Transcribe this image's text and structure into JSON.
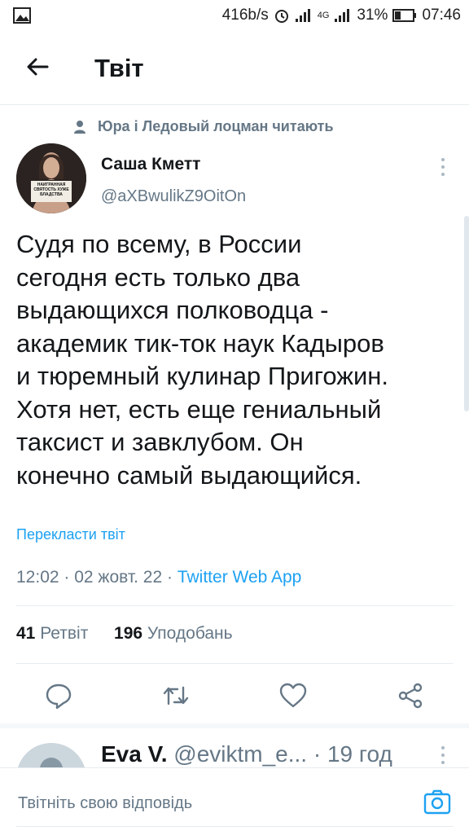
{
  "status": {
    "speed": "416b/s",
    "net": "4G",
    "battery": "31%",
    "time": "07:46"
  },
  "header": {
    "title": "Твіт"
  },
  "social_context": "Юра і Ледовый лоцман читають",
  "author": {
    "name": "Саша Кметт",
    "handle": "@aXBwulikZ9OitOn",
    "avatar_sign": "НАИГРАННАЯ СВЯТОСТЬ ХУЖЕ БЛАДСТВА"
  },
  "tweet": {
    "lines": [
      "Судя по всему, в России",
      "сегодня есть только два",
      "выдающихся полководца -",
      "академик тик-ток наук Кадыров",
      "и тюремный кулинар Пригожин.",
      "Хотя нет, есть еще гениальный",
      "таксист и завклубом. Он",
      "конечно самый выдающийся."
    ],
    "translate": "Перекласти твіт",
    "time": "12:02",
    "date": "02 жовт. 22",
    "app": "Twitter Web App"
  },
  "stats": {
    "retweets_count": "41",
    "retweets_label": "Ретвіт",
    "likes_count": "196",
    "likes_label": "Уподобань"
  },
  "actions": {
    "reply": "reply-icon",
    "retweet": "retweet-icon",
    "like": "heart-icon",
    "share": "share-icon"
  },
  "reply_preview": {
    "name": "Eva V.",
    "handle": "@eviktm_e...",
    "sep": "·",
    "age": "19 год"
  },
  "composer": {
    "placeholder": "Твітніть свою відповідь"
  },
  "colors": {
    "accent": "#1da1f2",
    "muted": "#657786",
    "text": "#14171a"
  }
}
